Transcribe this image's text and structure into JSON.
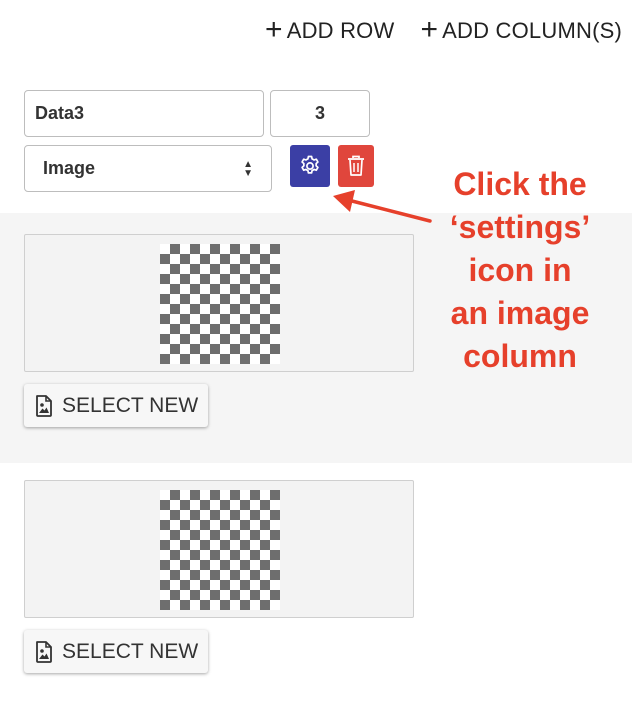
{
  "toolbar": {
    "add_row_label": "ADD ROW",
    "add_columns_label": "ADD COLUMN(S)"
  },
  "column": {
    "name": "Data3",
    "width": "3",
    "type": "Image"
  },
  "rows": [
    {
      "select_label": "SELECT NEW"
    },
    {
      "select_label": "SELECT NEW"
    }
  ],
  "annotation": {
    "lines": [
      "Click the",
      "‘settings’",
      "icon in",
      "an image",
      "column"
    ]
  },
  "colors": {
    "settings_button": "#3b3fa5",
    "delete_button": "#e0463c",
    "annotation": "#e6402b",
    "row_band": "#f5f5f5"
  }
}
